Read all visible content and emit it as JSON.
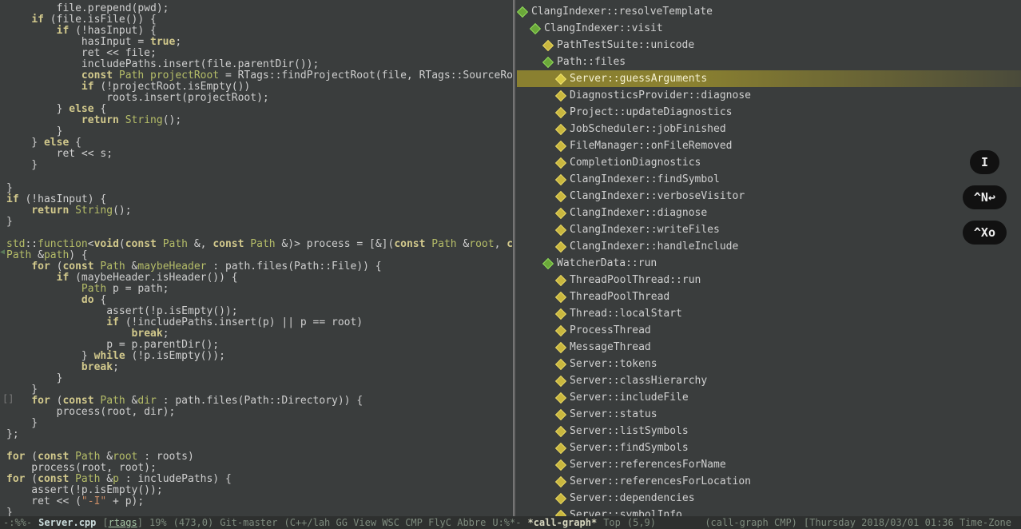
{
  "code_lines": [
    [
      [
        "pd",
        "        file.prepend(pwd);"
      ]
    ],
    [
      [
        "pd",
        "    "
      ],
      [
        "kw",
        "if"
      ],
      [
        "pd",
        " (file.isFile()) {"
      ]
    ],
    [
      [
        "pd",
        "        "
      ],
      [
        "kw",
        "if"
      ],
      [
        "pd",
        " (!hasInput) {"
      ]
    ],
    [
      [
        "pd",
        "            hasInput = "
      ],
      [
        "kw",
        "true"
      ],
      [
        "pd",
        ";"
      ]
    ],
    [
      [
        "pd",
        "            ret << file;"
      ]
    ],
    [
      [
        "pd",
        "            includePaths.insert(file.parentDir());"
      ]
    ],
    [
      [
        "pd",
        "            "
      ],
      [
        "kw",
        "const"
      ],
      [
        "pd",
        " "
      ],
      [
        "ty",
        "Path"
      ],
      [
        "pd",
        " "
      ],
      [
        "ty",
        "projectRoot"
      ],
      [
        "pd",
        " = RTags::findProjectRoot(file, RTags::SourceRoot);"
      ]
    ],
    [
      [
        "pd",
        "            "
      ],
      [
        "kw",
        "if"
      ],
      [
        "pd",
        " (!projectRoot.isEmpty())"
      ]
    ],
    [
      [
        "pd",
        "                roots.insert(projectRoot);"
      ]
    ],
    [
      [
        "pd",
        "        } "
      ],
      [
        "kw",
        "else"
      ],
      [
        "pd",
        " {"
      ]
    ],
    [
      [
        "pd",
        "            "
      ],
      [
        "kw",
        "return"
      ],
      [
        "pd",
        " "
      ],
      [
        "ty",
        "String"
      ],
      [
        "pd",
        "();"
      ]
    ],
    [
      [
        "pd",
        "        }"
      ]
    ],
    [
      [
        "pd",
        "    } "
      ],
      [
        "kw",
        "else"
      ],
      [
        "pd",
        " {"
      ]
    ],
    [
      [
        "pd",
        "        ret << s;"
      ]
    ],
    [
      [
        "pd",
        "    }"
      ]
    ],
    [
      [
        "pd",
        ""
      ]
    ],
    [
      [
        "pd",
        "}"
      ]
    ],
    [
      [
        "kw",
        "if"
      ],
      [
        "pd",
        " (!hasInput) {"
      ]
    ],
    [
      [
        "pd",
        "    "
      ],
      [
        "kw",
        "return"
      ],
      [
        "pd",
        " "
      ],
      [
        "ty",
        "String"
      ],
      [
        "pd",
        "();"
      ]
    ],
    [
      [
        "pd",
        "}"
      ]
    ],
    [
      [
        "pd",
        ""
      ]
    ],
    [
      [
        "ty",
        "std"
      ],
      [
        "pd",
        "::"
      ],
      [
        "ty",
        "function"
      ],
      [
        "pd",
        "<"
      ],
      [
        "kw",
        "void"
      ],
      [
        "pd",
        "("
      ],
      [
        "kw",
        "const"
      ],
      [
        "pd",
        " "
      ],
      [
        "ty",
        "Path"
      ],
      [
        "pd",
        " &, "
      ],
      [
        "kw",
        "const"
      ],
      [
        "pd",
        " "
      ],
      [
        "ty",
        "Path"
      ],
      [
        "pd",
        " &)> process = [&]("
      ],
      [
        "kw",
        "const"
      ],
      [
        "pd",
        " "
      ],
      [
        "ty",
        "Path"
      ],
      [
        "pd",
        " &"
      ],
      [
        "ty",
        "root"
      ],
      [
        "pd",
        ", "
      ],
      [
        "kw",
        "const"
      ]
    ],
    [
      [
        "ty",
        "Path"
      ],
      [
        "pd",
        " &"
      ],
      [
        "ty",
        "path"
      ],
      [
        "pd",
        ") {"
      ]
    ],
    [
      [
        "pd",
        "    "
      ],
      [
        "kw",
        "for"
      ],
      [
        "pd",
        " ("
      ],
      [
        "kw",
        "const"
      ],
      [
        "pd",
        " "
      ],
      [
        "ty",
        "Path"
      ],
      [
        "pd",
        " &"
      ],
      [
        "ty",
        "maybeHeader"
      ],
      [
        "pd",
        " : path.files(Path::File)) {"
      ]
    ],
    [
      [
        "pd",
        "        "
      ],
      [
        "kw",
        "if"
      ],
      [
        "pd",
        " (maybeHeader.isHeader()) {"
      ]
    ],
    [
      [
        "pd",
        "            "
      ],
      [
        "ty",
        "Path"
      ],
      [
        "pd",
        " p = path;"
      ]
    ],
    [
      [
        "pd",
        "            "
      ],
      [
        "kw",
        "do"
      ],
      [
        "pd",
        " {"
      ]
    ],
    [
      [
        "pd",
        "                assert(!p.isEmpty());"
      ]
    ],
    [
      [
        "pd",
        "                "
      ],
      [
        "kw",
        "if"
      ],
      [
        "pd",
        " (!includePaths.insert(p) || p == root)"
      ]
    ],
    [
      [
        "pd",
        "                    "
      ],
      [
        "kw",
        "break"
      ],
      [
        "pd",
        ";"
      ]
    ],
    [
      [
        "pd",
        "                p = p.parentDir();"
      ]
    ],
    [
      [
        "pd",
        "            } "
      ],
      [
        "kw",
        "while"
      ],
      [
        "pd",
        " (!p.isEmpty());"
      ]
    ],
    [
      [
        "pd",
        "            "
      ],
      [
        "kw",
        "break"
      ],
      [
        "pd",
        ";"
      ]
    ],
    [
      [
        "pd",
        "        }"
      ]
    ],
    [
      [
        "pd",
        "    }"
      ]
    ],
    [
      [
        "pd",
        "    "
      ],
      [
        "kw",
        "for"
      ],
      [
        "pd",
        " ("
      ],
      [
        "kw",
        "const"
      ],
      [
        "pd",
        " "
      ],
      [
        "ty",
        "Path"
      ],
      [
        "pd",
        " &"
      ],
      [
        "ty",
        "dir"
      ],
      [
        "pd",
        " : path.files(Path::Directory)) {"
      ]
    ],
    [
      [
        "pd",
        "        process(root, dir);"
      ]
    ],
    [
      [
        "pd",
        "    }"
      ]
    ],
    [
      [
        "pd",
        "};"
      ]
    ],
    [
      [
        "pd",
        ""
      ]
    ],
    [
      [
        "kw",
        "for"
      ],
      [
        "pd",
        " ("
      ],
      [
        "kw",
        "const"
      ],
      [
        "pd",
        " "
      ],
      [
        "ty",
        "Path"
      ],
      [
        "pd",
        " &"
      ],
      [
        "ty",
        "root"
      ],
      [
        "pd",
        " : roots)"
      ]
    ],
    [
      [
        "pd",
        "    process(root, root);"
      ]
    ],
    [
      [
        "kw",
        "for"
      ],
      [
        "pd",
        " ("
      ],
      [
        "kw",
        "const"
      ],
      [
        "pd",
        " "
      ],
      [
        "ty",
        "Path"
      ],
      [
        "pd",
        " &"
      ],
      [
        "ty",
        "p"
      ],
      [
        "pd",
        " : includePaths) {"
      ]
    ],
    [
      [
        "pd",
        "    assert(!p.isEmpty());"
      ]
    ],
    [
      [
        "pd",
        "    ret << ("
      ],
      [
        "str",
        "\"-I\""
      ],
      [
        "pd",
        " + p);"
      ]
    ],
    [
      [
        "pd",
        "}"
      ]
    ]
  ],
  "tree": [
    {
      "indent": 0,
      "color": "green",
      "label": "ClangIndexer::resolveTemplate",
      "selected": false
    },
    {
      "indent": 1,
      "color": "green",
      "label": "ClangIndexer::visit",
      "selected": false
    },
    {
      "indent": 2,
      "color": "yellow",
      "label": "PathTestSuite::unicode",
      "selected": false
    },
    {
      "indent": 2,
      "color": "green",
      "label": "Path::files",
      "selected": false
    },
    {
      "indent": 3,
      "color": "hl",
      "label": "Server::guessArguments",
      "selected": true
    },
    {
      "indent": 3,
      "color": "yellow",
      "label": "DiagnosticsProvider::diagnose",
      "selected": false
    },
    {
      "indent": 3,
      "color": "yellow",
      "label": "Project::updateDiagnostics",
      "selected": false
    },
    {
      "indent": 3,
      "color": "yellow",
      "label": "JobScheduler::jobFinished",
      "selected": false
    },
    {
      "indent": 3,
      "color": "yellow",
      "label": "FileManager::onFileRemoved",
      "selected": false
    },
    {
      "indent": 3,
      "color": "yellow",
      "label": "CompletionDiagnostics",
      "selected": false
    },
    {
      "indent": 3,
      "color": "yellow",
      "label": "ClangIndexer::findSymbol",
      "selected": false
    },
    {
      "indent": 3,
      "color": "yellow",
      "label": "ClangIndexer::verboseVisitor",
      "selected": false
    },
    {
      "indent": 3,
      "color": "yellow",
      "label": "ClangIndexer::diagnose",
      "selected": false
    },
    {
      "indent": 3,
      "color": "yellow",
      "label": "ClangIndexer::writeFiles",
      "selected": false
    },
    {
      "indent": 3,
      "color": "yellow",
      "label": "ClangIndexer::handleInclude",
      "selected": false
    },
    {
      "indent": 2,
      "color": "green",
      "label": "WatcherData::run",
      "selected": false
    },
    {
      "indent": 3,
      "color": "yellow",
      "label": "ThreadPoolThread::run",
      "selected": false
    },
    {
      "indent": 3,
      "color": "yellow",
      "label": "ThreadPoolThread",
      "selected": false
    },
    {
      "indent": 3,
      "color": "yellow",
      "label": "Thread::localStart",
      "selected": false
    },
    {
      "indent": 3,
      "color": "yellow",
      "label": "ProcessThread",
      "selected": false
    },
    {
      "indent": 3,
      "color": "yellow",
      "label": "MessageThread",
      "selected": false
    },
    {
      "indent": 3,
      "color": "yellow",
      "label": "Server::tokens",
      "selected": false
    },
    {
      "indent": 3,
      "color": "yellow",
      "label": "Server::classHierarchy",
      "selected": false
    },
    {
      "indent": 3,
      "color": "yellow",
      "label": "Server::includeFile",
      "selected": false
    },
    {
      "indent": 3,
      "color": "yellow",
      "label": "Server::status",
      "selected": false
    },
    {
      "indent": 3,
      "color": "yellow",
      "label": "Server::listSymbols",
      "selected": false
    },
    {
      "indent": 3,
      "color": "yellow",
      "label": "Server::findSymbols",
      "selected": false
    },
    {
      "indent": 3,
      "color": "yellow",
      "label": "Server::referencesForName",
      "selected": false
    },
    {
      "indent": 3,
      "color": "yellow",
      "label": "Server::referencesForLocation",
      "selected": false
    },
    {
      "indent": 3,
      "color": "yellow",
      "label": "Server::dependencies",
      "selected": false
    },
    {
      "indent": 3,
      "color": "yellow",
      "label": "Server::symbolInfo",
      "selected": false
    }
  ],
  "hints": [
    "I",
    "^N↩",
    "^Xo"
  ],
  "modeline": {
    "left_state": "-:%%-",
    "filename": "Server.cpp",
    "bracket": "rtags",
    "percent": "19%",
    "pos": "(473,0)",
    "vc": "Git-master",
    "modes": "(C++/lah GG View WSC CMP FlyC Abbre",
    "ustate": "U:%*-",
    "buffer2": "*call-graph*",
    "top": "Top",
    "pos2": "(5,9)",
    "right": "(call-graph CMP)",
    "date": "[Thursday 2018/03/01 01:36 Time-Zone"
  }
}
